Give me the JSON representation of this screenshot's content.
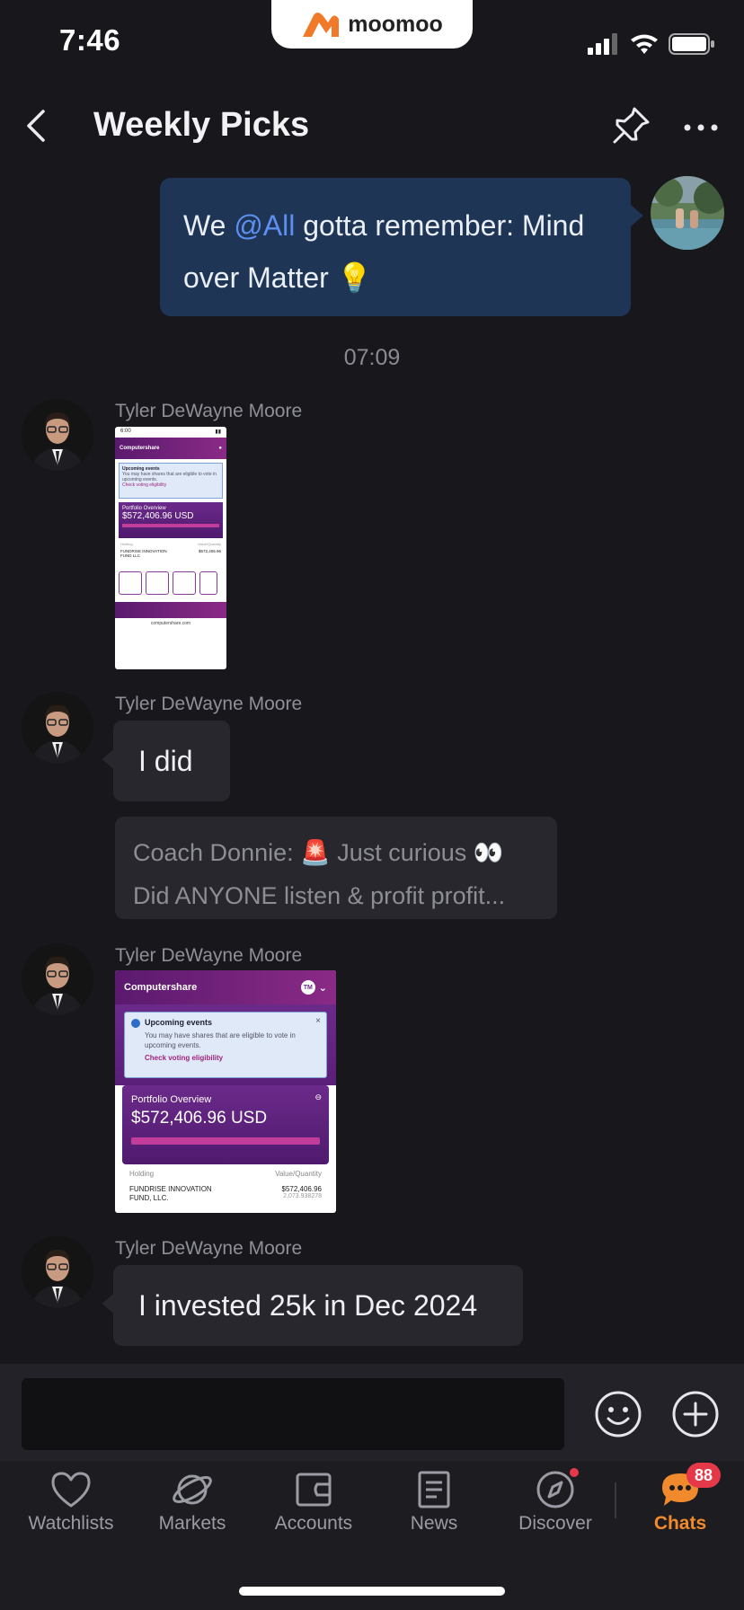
{
  "status_bar": {
    "time": "7:46",
    "app_brand": "moomoo"
  },
  "header": {
    "title": "Weekly Picks"
  },
  "messages": {
    "own": {
      "prefix": "We ",
      "mention": "@All",
      "text_line1_rest": " gotta remember: Mind",
      "text_line2": "over Matter 💡"
    },
    "timestamp": "07:09",
    "m1": {
      "sender": "Tyler DeWayne Moore",
      "shot": {
        "time": "6:00",
        "brand": "Computershare",
        "banner_title": "Upcoming events",
        "banner_text": "You may have shares that are eligible to vote in upcoming events.",
        "banner_link": "Check voting eligibility",
        "portfolio_label": "Portfolio Overview",
        "portfolio_value": "$572,406.96 USD",
        "col_holding": "Holding",
        "col_value": "Value/Quantity",
        "fund_name": "FUNDRISE INNOVATION FUND LLC",
        "fund_value": "$572,406.96",
        "url": "computershare.com"
      }
    },
    "m2": {
      "sender": "Tyler DeWayne Moore",
      "text": "I did"
    },
    "quote": {
      "line1": "Coach Donnie: 🚨 Just curious 👀",
      "line2": "Did ANYONE listen & profit profit..."
    },
    "m3": {
      "sender": "Tyler DeWayne Moore",
      "shot": {
        "brand": "Computershare",
        "user_initials": "TM",
        "banner_title": "Upcoming events",
        "banner_text": "You may have shares that are eligible to vote in upcoming events.",
        "banner_link": "Check voting eligibility",
        "portfolio_label": "Portfolio Overview",
        "portfolio_value": "$572,406.96 USD",
        "col_holding": "Holding",
        "col_value": "Value/Quantity",
        "fund_name": "FUNDRISE INNOVATION FUND, LLC.",
        "fund_value": "$572,406.96",
        "fund_qty": "2,073.938278"
      }
    },
    "m4": {
      "sender": "Tyler DeWayne Moore",
      "text": "I invested 25k in Dec 2024"
    }
  },
  "tabs": [
    {
      "label": "Watchlists",
      "icon": "heart-icon"
    },
    {
      "label": "Markets",
      "icon": "planet-icon"
    },
    {
      "label": "Accounts",
      "icon": "wallet-icon"
    },
    {
      "label": "News",
      "icon": "news-icon"
    },
    {
      "label": "Discover",
      "icon": "compass-icon"
    },
    {
      "label": "Chats",
      "icon": "chat-bubble-icon",
      "active": true,
      "badge": "88"
    }
  ],
  "colors": {
    "accent": "#f08a2c",
    "own_bubble": "#1f3556",
    "badge": "#e5394a",
    "mention": "#5d8ff0"
  }
}
